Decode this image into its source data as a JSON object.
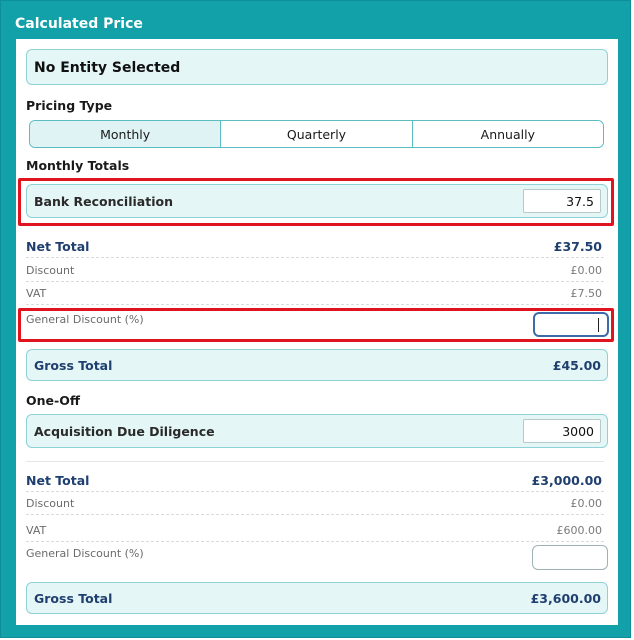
{
  "window": {
    "title": "Calculated Price"
  },
  "entity": {
    "label": "No Entity Selected"
  },
  "pricing_type": {
    "label": "Pricing Type",
    "options": [
      "Monthly",
      "Quarterly",
      "Annually"
    ],
    "selected": "Monthly"
  },
  "monthly": {
    "heading": "Monthly Totals",
    "items": [
      {
        "label": "Bank Reconciliation",
        "value": "37.5"
      }
    ],
    "net_total": {
      "label": "Net Total",
      "value": "£37.50"
    },
    "discount": {
      "label": "Discount",
      "value": "£0.00"
    },
    "vat": {
      "label": "VAT",
      "value": "£7.50"
    },
    "general_discount": {
      "label": "General Discount (%)",
      "value": ""
    },
    "gross_total": {
      "label": "Gross Total",
      "value": "£45.00"
    }
  },
  "one_off": {
    "heading": "One-Off",
    "items": [
      {
        "label": "Acquisition Due Diligence",
        "value": "3000"
      }
    ],
    "net_total": {
      "label": "Net Total",
      "value": "£3,000.00"
    },
    "discount": {
      "label": "Discount",
      "value": "£0.00"
    },
    "vat": {
      "label": "VAT",
      "value": "£600.00"
    },
    "general_discount": {
      "label": "General Discount (%)",
      "value": ""
    },
    "gross_total": {
      "label": "Gross Total",
      "value": "£3,600.00"
    }
  },
  "colors": {
    "frame": "#13a1a9",
    "panel_fill": "#e5f6f7",
    "highlight": "#e0141e",
    "total_text": "#1f3f6e"
  }
}
